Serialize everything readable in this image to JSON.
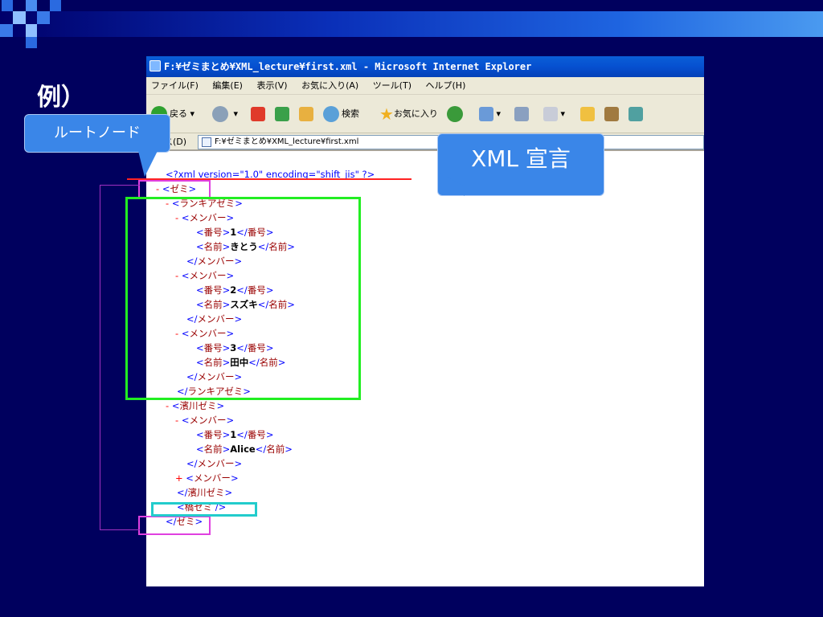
{
  "slide": {
    "title": "例）",
    "colors": {
      "background": "#00005e",
      "header_gradient_end": "#4a9af0",
      "callout": "#3a86e8",
      "root_box": "#e040e0",
      "group_box": "#22ee22",
      "decl_line": "#ff2222",
      "empty_elem_box": "#22cccc"
    }
  },
  "callouts": {
    "root_node": "ルートノード",
    "xml_declaration": "XML 宣言"
  },
  "browser": {
    "window_title": "F:¥ゼミまとめ¥XML_lecture¥first.xml - Microsoft Internet Explorer",
    "menu": [
      "ファイル(F)",
      "編集(E)",
      "表示(V)",
      "お気に入り(A)",
      "ツール(T)",
      "ヘルプ(H)"
    ],
    "toolbar": {
      "back_label": "戻る",
      "search_label": "検索",
      "favorites_label": "お気に入り"
    },
    "address": {
      "label": "ス(D)",
      "value": "F:¥ゼミまとめ¥XML_lecture¥first.xml"
    }
  },
  "xml": {
    "declaration": "<?xml version=\"1.0\" encoding=\"shift_jis\" ?>",
    "root_open": "ゼミ",
    "root_close": "ゼミ",
    "group1": {
      "name": "ランキアゼミ",
      "members": [
        {
          "number": "1",
          "name": "きとう"
        },
        {
          "number": "2",
          "name": "スズキ"
        },
        {
          "number": "3",
          "name": "田中"
        }
      ]
    },
    "group2": {
      "name": "濱川ゼミ",
      "members": [
        {
          "number": "1",
          "name": "Alice"
        }
      ]
    },
    "member_tag": "メンバー",
    "number_tag": "番号",
    "name_tag": "名前",
    "empty_elem": "橋ゼミ",
    "collapse_marker": "-",
    "expand_marker": "+"
  }
}
